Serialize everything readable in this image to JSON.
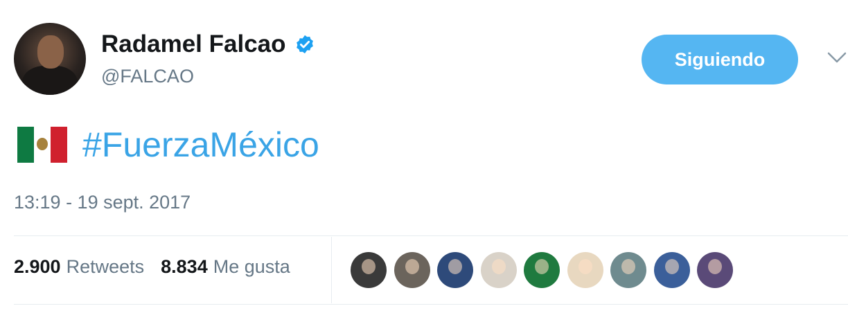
{
  "user": {
    "name": "Radamel Falcao",
    "handle": "@FALCAO",
    "verified": true
  },
  "follow_button": {
    "label": "Siguiendo",
    "color": "#55b6f2"
  },
  "tweet": {
    "flag": "mexico-flag",
    "hashtag": "#FuerzaMéxico",
    "timestamp": "13:19 - 19 sept. 2017"
  },
  "stats": {
    "retweets_count": "2.900",
    "retweets_label": "Retweets",
    "likes_count": "8.834",
    "likes_label": "Me gusta"
  },
  "likers": [
    {
      "name": "liker-1",
      "color": "#3a3a3a"
    },
    {
      "name": "liker-2",
      "color": "#6b645c"
    },
    {
      "name": "liker-3",
      "color": "#2e4a7a"
    },
    {
      "name": "liker-4",
      "color": "#d9d2c8"
    },
    {
      "name": "liker-5",
      "color": "#1f7a3f"
    },
    {
      "name": "liker-6",
      "color": "#e8d8c0"
    },
    {
      "name": "liker-7",
      "color": "#6f8b8f"
    },
    {
      "name": "liker-8",
      "color": "#3b5f9a"
    },
    {
      "name": "liker-9",
      "color": "#5a4a78"
    }
  ],
  "colors": {
    "link": "#3aa4e6",
    "muted": "#657786",
    "text": "#14171a"
  }
}
